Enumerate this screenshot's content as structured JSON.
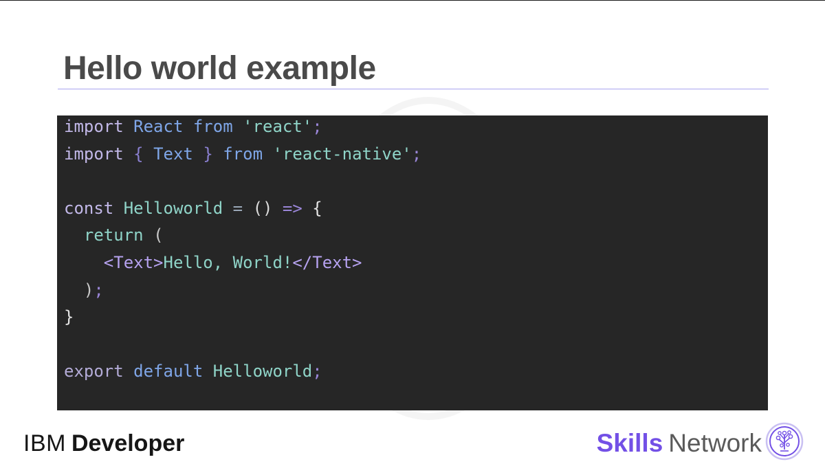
{
  "slide": {
    "title": "Hello world example"
  },
  "code": {
    "lines": [
      [
        {
          "t": "import",
          "c": "#c2b8e8"
        },
        {
          "t": " ",
          "c": "#d0d0d0"
        },
        {
          "t": "React",
          "c": "#7fa6e8"
        },
        {
          "t": " ",
          "c": "#d0d0d0"
        },
        {
          "t": "from",
          "c": "#7fa6e8"
        },
        {
          "t": " ",
          "c": "#d0d0d0"
        },
        {
          "t": "'react'",
          "c": "#8fd4c8"
        },
        {
          "t": ";",
          "c": "#9a86d8"
        }
      ],
      [
        {
          "t": "import",
          "c": "#c2b8e8"
        },
        {
          "t": " ",
          "c": "#d0d0d0"
        },
        {
          "t": "{",
          "c": "#8a7fd0"
        },
        {
          "t": " ",
          "c": "#d0d0d0"
        },
        {
          "t": "Text",
          "c": "#7fa6e8"
        },
        {
          "t": " ",
          "c": "#d0d0d0"
        },
        {
          "t": "}",
          "c": "#8a7fd0"
        },
        {
          "t": " ",
          "c": "#d0d0d0"
        },
        {
          "t": "from",
          "c": "#7fa6e8"
        },
        {
          "t": " ",
          "c": "#d0d0d0"
        },
        {
          "t": "'react-native'",
          "c": "#8fd4c8"
        },
        {
          "t": ";",
          "c": "#9a86d8"
        }
      ],
      [],
      [
        {
          "t": "const",
          "c": "#c2b8e8"
        },
        {
          "t": " ",
          "c": "#d0d0d0"
        },
        {
          "t": "Helloworld",
          "c": "#8fd4c8"
        },
        {
          "t": " ",
          "c": "#d0d0d0"
        },
        {
          "t": "=",
          "c": "#9aa8b8"
        },
        {
          "t": " ",
          "c": "#d0d0d0"
        },
        {
          "t": "()",
          "c": "#dcdcdc"
        },
        {
          "t": " ",
          "c": "#d0d0d0"
        },
        {
          "t": "=>",
          "c": "#9a86d8"
        },
        {
          "t": " ",
          "c": "#d0d0d0"
        },
        {
          "t": "{",
          "c": "#e6e6e6"
        }
      ],
      [
        {
          "t": "  ",
          "c": "#d0d0d0"
        },
        {
          "t": "return",
          "c": "#8fd4c8"
        },
        {
          "t": " ",
          "c": "#d0d0d0"
        },
        {
          "t": "(",
          "c": "#c8c8c8"
        }
      ],
      [
        {
          "t": "    ",
          "c": "#d0d0d0"
        },
        {
          "t": "<Text>",
          "c": "#b6a2f0"
        },
        {
          "t": "Hello, World!",
          "c": "#8fd4c8"
        },
        {
          "t": "</Text>",
          "c": "#b6a2f0"
        }
      ],
      [
        {
          "t": "  ",
          "c": "#d0d0d0"
        },
        {
          "t": ")",
          "c": "#c8c8c8"
        },
        {
          "t": ";",
          "c": "#9a86d8"
        }
      ],
      [
        {
          "t": "}",
          "c": "#e6e6e6"
        }
      ],
      [],
      [
        {
          "t": "export",
          "c": "#b4acd8"
        },
        {
          "t": " ",
          "c": "#d0d0d0"
        },
        {
          "t": "default",
          "c": "#7fa6e8"
        },
        {
          "t": " ",
          "c": "#d0d0d0"
        },
        {
          "t": "Helloworld",
          "c": "#8fd4c8"
        },
        {
          "t": ";",
          "c": "#9a86d8"
        }
      ]
    ]
  },
  "footer": {
    "ibm": "IBM",
    "developer": "Developer",
    "skills": "Skills",
    "network": "Network"
  },
  "icons": {
    "skills_network_logo": "tree-circle-logo"
  },
  "colors": {
    "accent": "#7350e6",
    "code_background": "#262626",
    "title": "#4a4a4a",
    "rule": "#a9a4f0"
  }
}
